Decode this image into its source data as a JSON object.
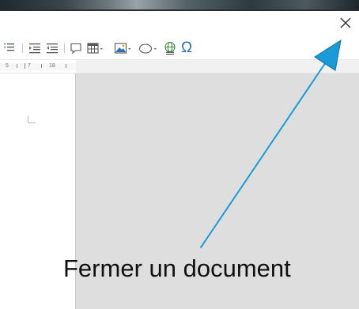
{
  "window": {
    "close_icon": "close-icon"
  },
  "toolbar": {
    "items": [
      "indent-list-icon",
      "increase-indent-icon",
      "decrease-indent-icon",
      "comment-icon",
      "insert-table-icon",
      "insert-image-icon",
      "insert-shape-icon",
      "hyperlink-icon",
      "special-character-icon"
    ],
    "special_char_glyph": "Ω"
  },
  "ruler": {
    "labels": [
      "5",
      "7",
      "18"
    ]
  },
  "annotation": {
    "caption": "Fermer un document",
    "arrow_color": "#1a9ad6"
  },
  "colors": {
    "workspace": "#dedede",
    "icon_blue": "#2a6ebb",
    "icon_green": "#3c8c3c"
  }
}
